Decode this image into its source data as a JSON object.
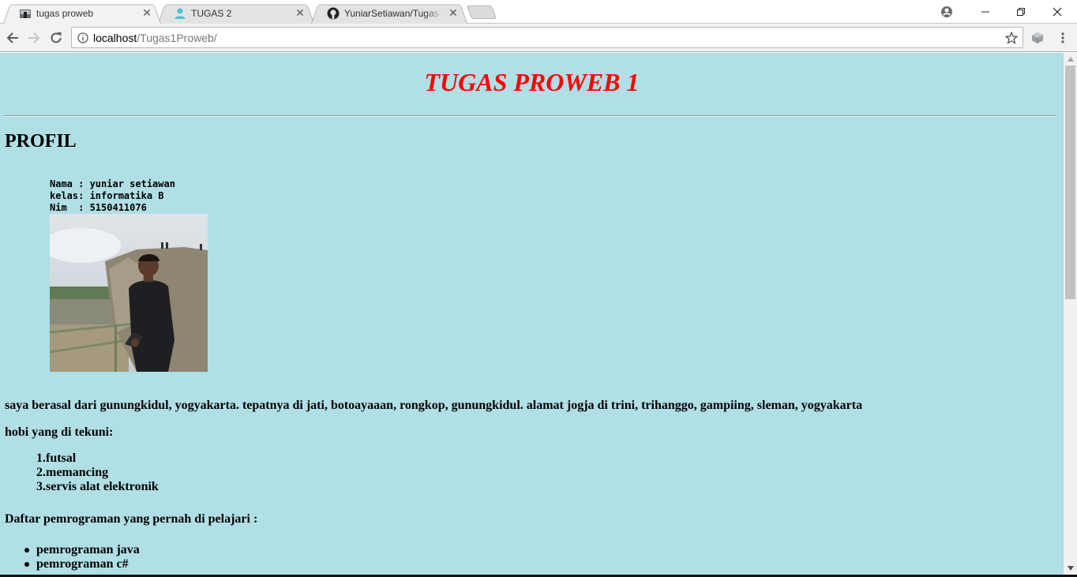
{
  "browser": {
    "tabs": [
      {
        "title": "tugas proweb",
        "active": true,
        "favicon": "photo-favicon"
      },
      {
        "title": "TUGAS 2",
        "active": false,
        "favicon": "person-icon"
      },
      {
        "title": "YuniarSetiawan/Tugas-ht",
        "active": false,
        "favicon": "github-icon"
      }
    ],
    "url_host": "localhost",
    "url_path": "/Tugas1Proweb/"
  },
  "page": {
    "title": "TUGAS PROWEB 1",
    "profile_heading": "PROFIL",
    "profile_pre": "Nama : yuniar setiawan\nkelas: informatika B\nNim  : 5150411076",
    "origin_text": "saya berasal dari gunungkidul, yogyakarta. tepatnya di jati, botoayaaan, rongkop, gunungkidul. alamat jogja di trini, trihanggo, gampiing, sleman, yogyakarta",
    "hobbies_heading": "hobi yang di tekuni:",
    "hobbies": [
      "1.futsal",
      "2.memancing",
      "3.servis alat elektronik"
    ],
    "programming_heading": "Daftar pemrograman yang pernah di pelajari :",
    "programming": [
      "pemrograman java",
      "pemrograman c#"
    ]
  },
  "colors": {
    "page_background": "#b0dfe5",
    "title_color": "#ff0000"
  }
}
